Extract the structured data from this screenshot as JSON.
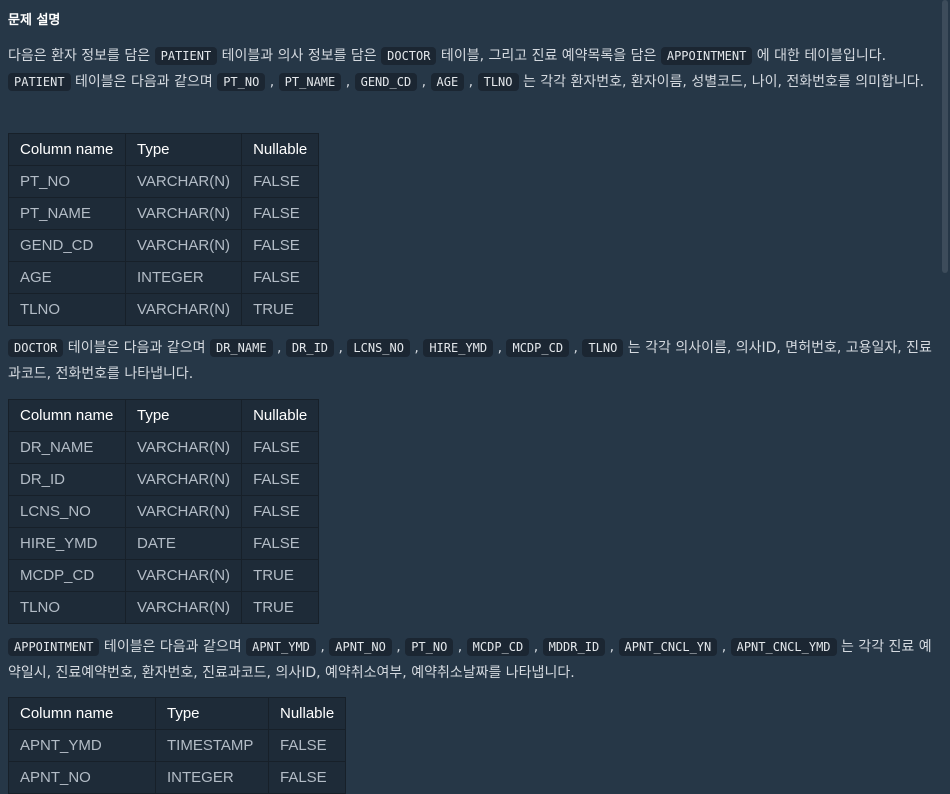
{
  "heading": "문제 설명",
  "intro": {
    "t1": "다음은 환자 정보를 담은 ",
    "c1": "PATIENT",
    "t2": " 테이블과 의사 정보를 담은 ",
    "c2": "DOCTOR",
    "t3": " 테이블, 그리고 진료 예약목록을 담은 ",
    "c3": "APPOINTMENT",
    "t4": " 에 대한 테이블입니다."
  },
  "patient_desc": {
    "code": "PATIENT",
    "t1": " 테이블은 다음과 같으며 ",
    "cols": [
      "PT_NO",
      "PT_NAME",
      "GEND_CD",
      "AGE",
      "TLNO"
    ],
    "t2": " 는 각각 환자번호, 환자이름, 성별코드, 나이, 전화번호를 의미합니다."
  },
  "doctor_desc": {
    "code": "DOCTOR",
    "t1": " 테이블은 다음과 같으며 ",
    "cols": [
      "DR_NAME",
      "DR_ID",
      "LCNS_NO",
      "HIRE_YMD",
      "MCDP_CD",
      "TLNO"
    ],
    "t2": " 는 각각 의사이름, 의사ID, 면허번호, 고용일자, 진료과코드, 전화번호를 나타냅니다."
  },
  "appointment_desc": {
    "code": "APPOINTMENT",
    "t1": " 테이블은 다음과 같으며 ",
    "cols": [
      "APNT_YMD",
      "APNT_NO",
      "PT_NO",
      "MCDP_CD",
      "MDDR_ID",
      "APNT_CNCL_YN",
      "APNT_CNCL_YMD"
    ],
    "t2": " 는 각각 진료 예약일시, 진료예약번호, 환자번호, 진료과코드, 의사ID, 예약취소여부, 예약취소날짜를 나타냅니다."
  },
  "headers": [
    "Column name",
    "Type",
    "Nullable"
  ],
  "patient_table": [
    [
      "PT_NO",
      "VARCHAR(N)",
      "FALSE"
    ],
    [
      "PT_NAME",
      "VARCHAR(N)",
      "FALSE"
    ],
    [
      "GEND_CD",
      "VARCHAR(N)",
      "FALSE"
    ],
    [
      "AGE",
      "INTEGER",
      "FALSE"
    ],
    [
      "TLNO",
      "VARCHAR(N)",
      "TRUE"
    ]
  ],
  "doctor_table": [
    [
      "DR_NAME",
      "VARCHAR(N)",
      "FALSE"
    ],
    [
      "DR_ID",
      "VARCHAR(N)",
      "FALSE"
    ],
    [
      "LCNS_NO",
      "VARCHAR(N)",
      "FALSE"
    ],
    [
      "HIRE_YMD",
      "DATE",
      "FALSE"
    ],
    [
      "MCDP_CD",
      "VARCHAR(N)",
      "TRUE"
    ],
    [
      "TLNO",
      "VARCHAR(N)",
      "TRUE"
    ]
  ],
  "appointment_table": [
    [
      "APNT_YMD",
      "TIMESTAMP",
      "FALSE"
    ],
    [
      "APNT_NO",
      "INTEGER",
      "FALSE"
    ]
  ]
}
